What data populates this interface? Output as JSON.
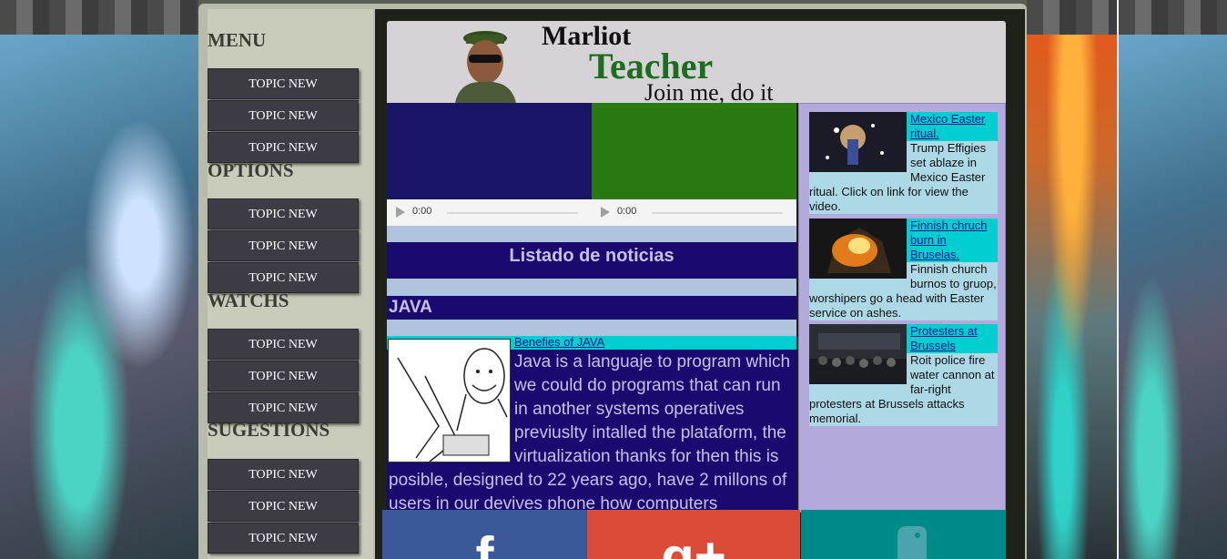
{
  "sidebar": {
    "sections": [
      {
        "heading": "MENU",
        "items": [
          "TOPIC NEW",
          "TOPIC NEW",
          "TOPIC NEW"
        ]
      },
      {
        "heading": "OPTIONS",
        "items": [
          "TOPIC NEW",
          "TOPIC NEW",
          "TOPIC NEW"
        ]
      },
      {
        "heading": "WATCHS",
        "items": [
          "TOPIC NEW",
          "TOPIC NEW",
          "TOPIC NEW"
        ]
      },
      {
        "heading": "SUGESTIONS",
        "items": [
          "TOPIC NEW",
          "TOPIC NEW",
          "TOPIC NEW"
        ]
      }
    ]
  },
  "header": {
    "logo_line1": "Marliot",
    "logo_line2": "Teacher",
    "logo_line3": "Join me, do it"
  },
  "videos": [
    {
      "time": "0:00",
      "color": "#1a1466"
    },
    {
      "time": "0:00",
      "color": "#2a7a12"
    }
  ],
  "news": {
    "title": "Listado de noticias",
    "section": "JAVA",
    "article": {
      "link": "Benefies of JAVA",
      "body": "Java is a languaje to program which we could do programs that can run in another systems operatives previuslty intalled the plataform, the virtualization thanks for then this is posible, designed to 22 years ago, have 2 millons of users in our devives phone how computers personals"
    }
  },
  "side_news": [
    {
      "title": "Mexico Easter ritual.",
      "body": "Trump Effigies set ablaze in Mexico Easter ritual. Click on link for view the video."
    },
    {
      "title": "Finnish chruch burn in Bruselas.",
      "body": "Finnish church burnos to gruop, worshipers go a head with Easter service on ashes."
    },
    {
      "title": "Protesters at Brussels",
      "body": "Roit police fire water cannon at far-right protesters at Brussels attacks memorial."
    }
  ],
  "social": [
    {
      "icon": "facebook-icon",
      "glyph": "f",
      "color": "#3b5998"
    },
    {
      "icon": "google-plus-icon",
      "glyph": "g+",
      "color": "#dc4a38"
    },
    {
      "icon": "python-icon",
      "glyph": "",
      "color": "#008b8b"
    }
  ]
}
